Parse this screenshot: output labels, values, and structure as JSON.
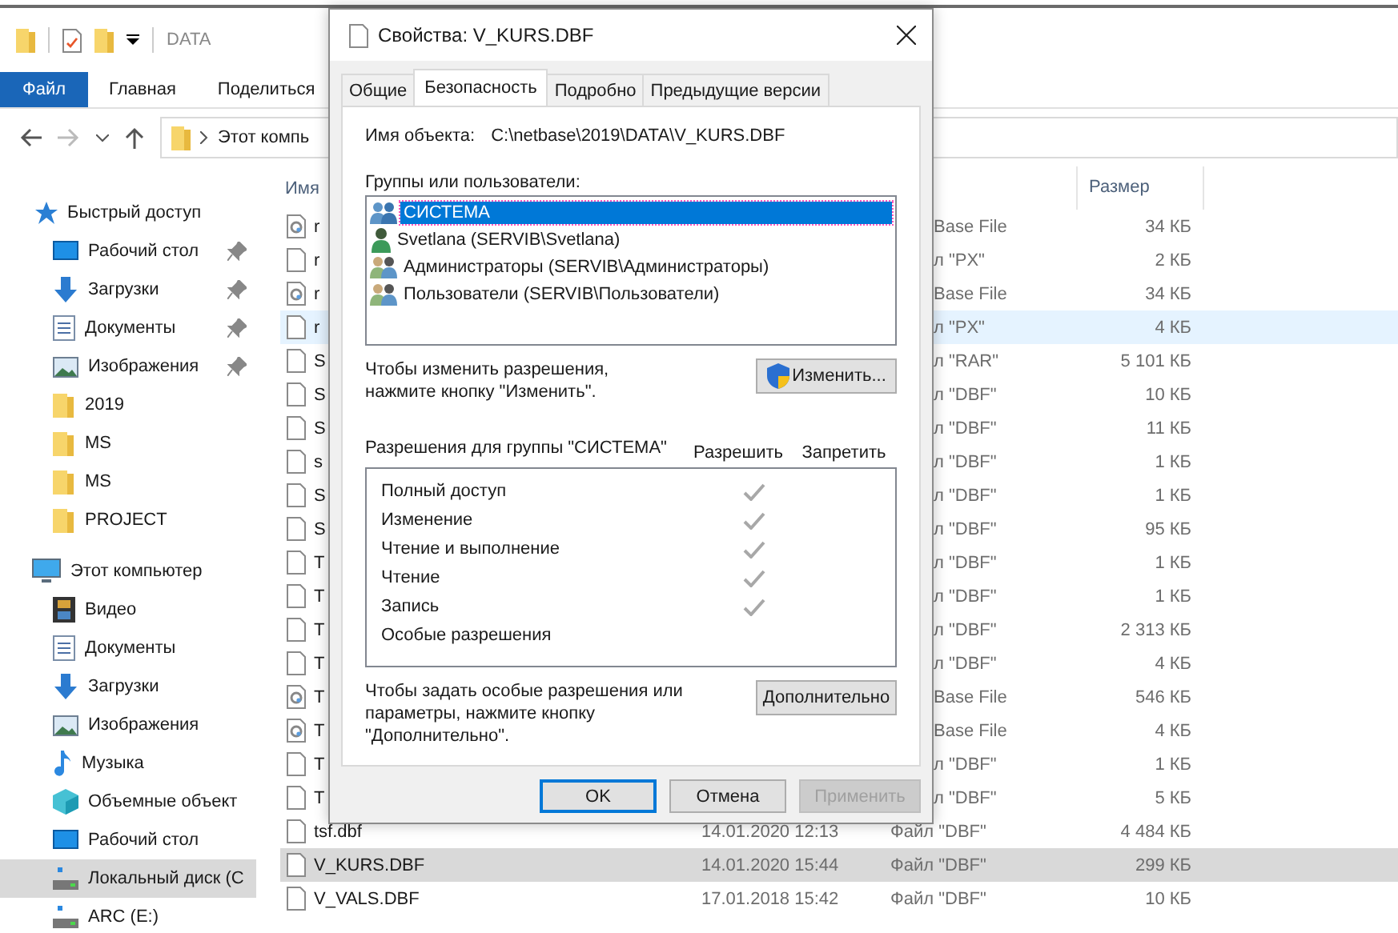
{
  "explorer": {
    "title": "DATA",
    "ribbon_tabs": [
      {
        "label": "Файл",
        "selected": true
      },
      {
        "label": "Главная",
        "selected": false
      },
      {
        "label": "Поделиться",
        "selected": false
      }
    ],
    "address": "Этот компь",
    "sidebar": [
      {
        "label": "Быстрый доступ",
        "kind": "star",
        "children": [
          {
            "label": "Рабочий стол",
            "kind": "desktop",
            "pinned": true,
            "selected": false
          },
          {
            "label": "Загрузки",
            "kind": "download",
            "pinned": true,
            "selected": false
          },
          {
            "label": "Документы",
            "kind": "document",
            "pinned": true,
            "selected": false
          },
          {
            "label": "Изображения",
            "kind": "image",
            "pinned": true,
            "selected": false
          },
          {
            "label": "2019",
            "kind": "folder",
            "pinned": false,
            "selected": false
          },
          {
            "label": "MS",
            "kind": "folder",
            "pinned": false,
            "selected": false
          },
          {
            "label": "MS",
            "kind": "folder",
            "pinned": false,
            "selected": false
          },
          {
            "label": "PROJECT",
            "kind": "folder",
            "pinned": false,
            "selected": false
          }
        ]
      },
      {
        "label": "Этот компьютер",
        "kind": "computer",
        "children": [
          {
            "label": "Видео",
            "kind": "video",
            "pinned": false,
            "selected": false
          },
          {
            "label": "Документы",
            "kind": "document",
            "pinned": false,
            "selected": false
          },
          {
            "label": "Загрузки",
            "kind": "download",
            "pinned": false,
            "selected": false
          },
          {
            "label": "Изображения",
            "kind": "image",
            "pinned": false,
            "selected": false
          },
          {
            "label": "Музыка",
            "kind": "music",
            "pinned": false,
            "selected": false
          },
          {
            "label": "Объемные объект",
            "kind": "cube",
            "pinned": false,
            "selected": false
          },
          {
            "label": "Рабочий стол",
            "kind": "desktop",
            "pinned": false,
            "selected": false
          },
          {
            "label": "Локальный диск (C",
            "kind": "drive",
            "pinned": false,
            "selected": true
          },
          {
            "label": "ARC (E:)",
            "kind": "drive",
            "pinned": false,
            "selected": false
          }
        ]
      }
    ],
    "columns": {
      "name": "Имя",
      "size": "Размер"
    },
    "rows": [
      {
        "name": "r",
        "kind": "gear",
        "type": "Base File",
        "size": "34 КБ",
        "hovered": false,
        "selected": false
      },
      {
        "name": "r",
        "kind": "blank",
        "type": "л \"PX\"",
        "size": "2 КБ",
        "hovered": false,
        "selected": false
      },
      {
        "name": "r",
        "kind": "gear",
        "type": "Base File",
        "size": "34 КБ",
        "hovered": false,
        "selected": false
      },
      {
        "name": "r",
        "kind": "blank",
        "type": "л \"PX\"",
        "size": "4 КБ",
        "hovered": true,
        "selected": false
      },
      {
        "name": "S",
        "kind": "blank",
        "type": "л \"RAR\"",
        "size": "5 101 КБ",
        "hovered": false,
        "selected": false
      },
      {
        "name": "S",
        "kind": "blank",
        "type": "л \"DBF\"",
        "size": "10 КБ",
        "hovered": false,
        "selected": false
      },
      {
        "name": "S",
        "kind": "blank",
        "type": "л \"DBF\"",
        "size": "11 КБ",
        "hovered": false,
        "selected": false
      },
      {
        "name": "s",
        "kind": "blank",
        "type": "л \"DBF\"",
        "size": "1 КБ",
        "hovered": false,
        "selected": false
      },
      {
        "name": "S",
        "kind": "blank",
        "type": "л \"DBF\"",
        "size": "1 КБ",
        "hovered": false,
        "selected": false
      },
      {
        "name": "S",
        "kind": "blank",
        "type": "л \"DBF\"",
        "size": "95 КБ",
        "hovered": false,
        "selected": false
      },
      {
        "name": "T",
        "kind": "blank",
        "type": "л \"DBF\"",
        "size": "1 КБ",
        "hovered": false,
        "selected": false
      },
      {
        "name": "T",
        "kind": "blank",
        "type": "л \"DBF\"",
        "size": "1 КБ",
        "hovered": false,
        "selected": false
      },
      {
        "name": "T",
        "kind": "blank",
        "type": "л \"DBF\"",
        "size": "2 313 КБ",
        "hovered": false,
        "selected": false
      },
      {
        "name": "T",
        "kind": "blank",
        "type": "л \"DBF\"",
        "size": "4 КБ",
        "hovered": false,
        "selected": false
      },
      {
        "name": "T",
        "kind": "gear",
        "type": "Base File",
        "size": "546 КБ",
        "hovered": false,
        "selected": false
      },
      {
        "name": "T",
        "kind": "gear",
        "type": "Base File",
        "size": "4 КБ",
        "hovered": false,
        "selected": false
      },
      {
        "name": "T",
        "kind": "blank",
        "type": "л \"DBF\"",
        "size": "1 КБ",
        "hovered": false,
        "selected": false
      },
      {
        "name": "T",
        "kind": "blank",
        "type": "л \"DBF\"",
        "size": "5 КБ",
        "hovered": false,
        "selected": false
      },
      {
        "name": "tsf.dbf",
        "kind": "blank",
        "date": "14.01.2020 12:13",
        "type": "Файл \"DBF\"",
        "size": "4 484 КБ",
        "hovered": false,
        "selected": false
      },
      {
        "name": "V_KURS.DBF",
        "kind": "blank",
        "date": "14.01.2020 15:44",
        "type": "Файл \"DBF\"",
        "size": "299 КБ",
        "hovered": false,
        "selected": true
      },
      {
        "name": "V_VALS.DBF",
        "kind": "blank",
        "date": "17.01.2018 15:42",
        "type": "Файл \"DBF\"",
        "size": "10 КБ",
        "hovered": false,
        "selected": false
      }
    ]
  },
  "dialog": {
    "title": "Свойства: V_KURS.DBF",
    "tabs": [
      {
        "label": "Общие",
        "selected": false
      },
      {
        "label": "Безопасность",
        "selected": true
      },
      {
        "label": "Подробно",
        "selected": false
      },
      {
        "label": "Предыдущие версии",
        "selected": false
      }
    ],
    "object_label": "Имя объекта:",
    "object_path": "C:\\netbase\\2019\\DATA\\V_KURS.DBF",
    "groups_label": "Группы или пользователи:",
    "principals": [
      {
        "name": "СИСТЕМА",
        "kind": "group",
        "selected": true
      },
      {
        "name": "Svetlana (SERVIB\\Svetlana)",
        "kind": "user",
        "selected": false
      },
      {
        "name": "Администраторы (SERVIB\\Администраторы)",
        "kind": "group-mixed",
        "selected": false
      },
      {
        "name": "Пользователи (SERVIB\\Пользователи)",
        "kind": "group-mixed",
        "selected": false
      }
    ],
    "change_hint": "Чтобы изменить разрешения,\nнажмите кнопку \"Изменить\".",
    "change_button": "Изменить...",
    "permissions_label": "Разрешения для группы \"СИСТЕМА\"",
    "allow_label": "Разрешить",
    "deny_label": "Запретить",
    "permissions": [
      {
        "name": "Полный доступ",
        "allow": true,
        "deny": false
      },
      {
        "name": "Изменение",
        "allow": true,
        "deny": false
      },
      {
        "name": "Чтение и выполнение",
        "allow": true,
        "deny": false
      },
      {
        "name": "Чтение",
        "allow": true,
        "deny": false
      },
      {
        "name": "Запись",
        "allow": true,
        "deny": false
      },
      {
        "name": "Особые разрешения",
        "allow": false,
        "deny": false
      }
    ],
    "advanced_hint": "Чтобы задать особые разрешения или\nпараметры, нажмите кнопку\n\"Дополнительно\".",
    "advanced_button": "Дополнительно",
    "buttons": [
      {
        "label": "OK",
        "kind": "default",
        "disabled": false
      },
      {
        "label": "Отмена",
        "kind": "normal",
        "disabled": false
      },
      {
        "label": "Применить",
        "kind": "normal",
        "disabled": true
      }
    ]
  }
}
